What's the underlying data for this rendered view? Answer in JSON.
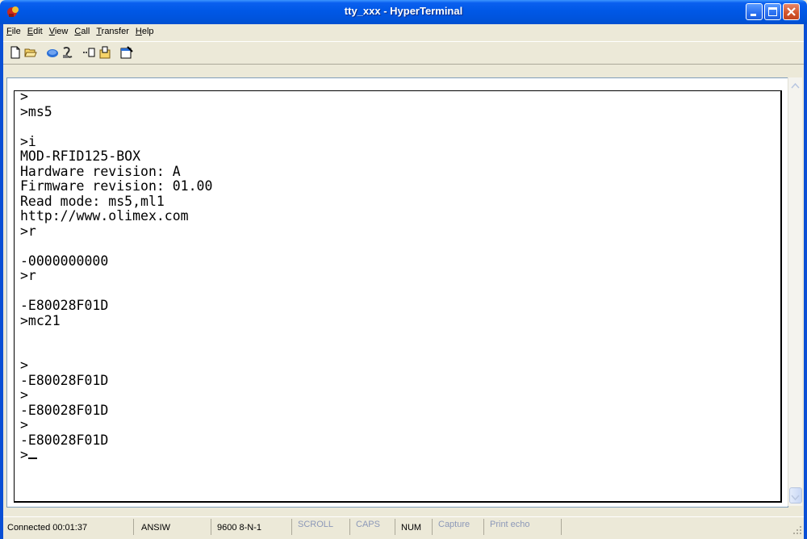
{
  "window": {
    "title": "tty_xxx - HyperTerminal"
  },
  "menu": [
    {
      "accel": "F",
      "rest": "ile"
    },
    {
      "accel": "E",
      "rest": "dit"
    },
    {
      "accel": "V",
      "rest": "iew"
    },
    {
      "accel": "C",
      "rest": "all"
    },
    {
      "accel": "T",
      "rest": "ransfer"
    },
    {
      "accel": "H",
      "rest": "elp"
    }
  ],
  "toolbar": [
    "new-document-icon",
    "open-folder-icon",
    "connect-phone-icon",
    "disconnect-phone-icon",
    "send-icon",
    "receive-icon",
    "properties-icon"
  ],
  "terminal": {
    "text": ">\n>ms5\n\n>i\nMOD-RFID125-BOX\nHardware revision: A\nFirmware revision: 01.00\nRead mode: ms5,ml1\nhttp://www.olimex.com\n>r\n\n-0000000000\n>r\n\n-E80028F01D\n>mc21\n\n\n>\n-E80028F01D\n>\n-E80028F01D\n>\n-E80028F01D\n>"
  },
  "status": {
    "connected": "Connected 00:01:37",
    "emulation": "ANSIW",
    "port": "9600 8-N-1",
    "scroll": "SCROLL",
    "caps": "CAPS",
    "num": "NUM",
    "capture": "Capture",
    "print": "Print echo"
  },
  "colors": {
    "title_bar": "#0054DD",
    "window_bg": "#ECE9D8",
    "terminal_bg": "#FFFFFF",
    "status_dim": "#8C98B8"
  }
}
